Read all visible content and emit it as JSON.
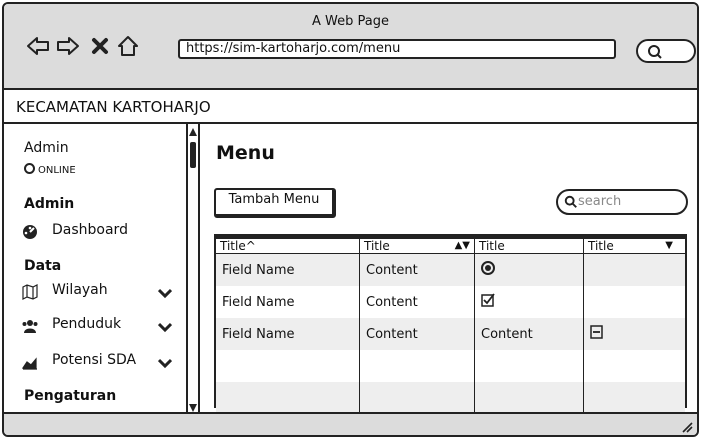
{
  "browser": {
    "window_title": "A Web Page",
    "url": "https://sim-kartoharjo.com/menu",
    "nav_icons": [
      "back-arrow-icon",
      "forward-arrow-icon",
      "close-icon",
      "home-icon"
    ]
  },
  "header": {
    "title": "KECAMATAN KARTOHARJO"
  },
  "sidebar": {
    "user_name": "Admin",
    "user_status": "ONLINE",
    "sections": [
      {
        "heading": "Admin",
        "items": [
          {
            "label": "Dashboard",
            "icon": "dashboard-icon",
            "chevron": false
          }
        ]
      },
      {
        "heading": "Data",
        "items": [
          {
            "label": "Wilayah",
            "icon": "map-icon",
            "chevron": true
          },
          {
            "label": "Penduduk",
            "icon": "users-icon",
            "chevron": true
          },
          {
            "label": "Potensi SDA",
            "icon": "area-chart-icon",
            "chevron": true
          }
        ]
      },
      {
        "heading": "Pengaturan",
        "items": []
      }
    ]
  },
  "main": {
    "page_title": "Menu",
    "add_button": "Tambah Menu",
    "search_placeholder": "search",
    "table": {
      "headers": [
        "Title^",
        "Title",
        "Title",
        "Title"
      ],
      "rows": [
        [
          "Field Name",
          "Content",
          "radio-selected",
          ""
        ],
        [
          "Field Name",
          "Content",
          "checkbox-checked",
          ""
        ],
        [
          "Field Name",
          "Content",
          "Content",
          "collapse-box"
        ],
        [
          "",
          "",
          "",
          ""
        ],
        [
          "",
          "",
          "",
          ""
        ]
      ]
    }
  }
}
